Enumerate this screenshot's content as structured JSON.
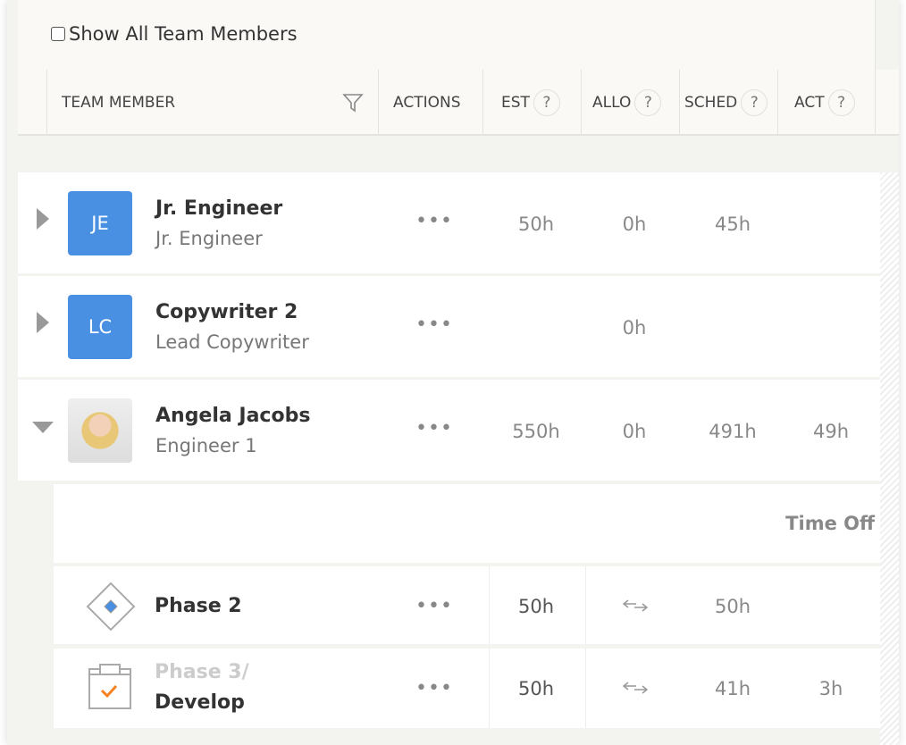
{
  "toolbar": {
    "show_all_label": "Show All Team Members",
    "show_all_checked": false
  },
  "columns": {
    "team_member": "TEAM MEMBER",
    "actions": "ACTIONS",
    "est": "EST",
    "allo": "ALLO",
    "sched": "SCHED",
    "act": "ACT",
    "help": "?"
  },
  "members": [
    {
      "initials": "JE",
      "name": "Jr. Engineer",
      "role": "Jr. Engineer",
      "est": "50h",
      "allo": "0h",
      "sched": "45h",
      "act": "",
      "expanded": false,
      "avatar_color": "#4a90e2"
    },
    {
      "initials": "LC",
      "name": "Copywriter 2",
      "role": "Lead Copywriter",
      "est": "",
      "allo": "0h",
      "sched": "",
      "act": "",
      "expanded": false,
      "avatar_color": "#4a90e2"
    },
    {
      "initials": "",
      "name": "Angela Jacobs",
      "role": "Engineer 1",
      "est": "550h",
      "allo": "0h",
      "sched": "491h",
      "act": "49h",
      "expanded": true
    }
  ],
  "time_off_label": "Time Off",
  "phases": [
    {
      "name": "Phase 2",
      "parent": "",
      "est": "50h",
      "allo_icon": "swap-arrows-icon",
      "sched": "50h",
      "act": "",
      "icon": "milestone-diamond-icon"
    },
    {
      "parent": "Phase 3/",
      "name": "Develop",
      "est": "50h",
      "allo_icon": "swap-arrows-icon",
      "sched": "41h",
      "act": "3h",
      "icon": "clipboard-check-icon"
    }
  ],
  "actions_glyph": "•••",
  "colors": {
    "avatar": "#4a90e2",
    "check": "#f5821f"
  }
}
